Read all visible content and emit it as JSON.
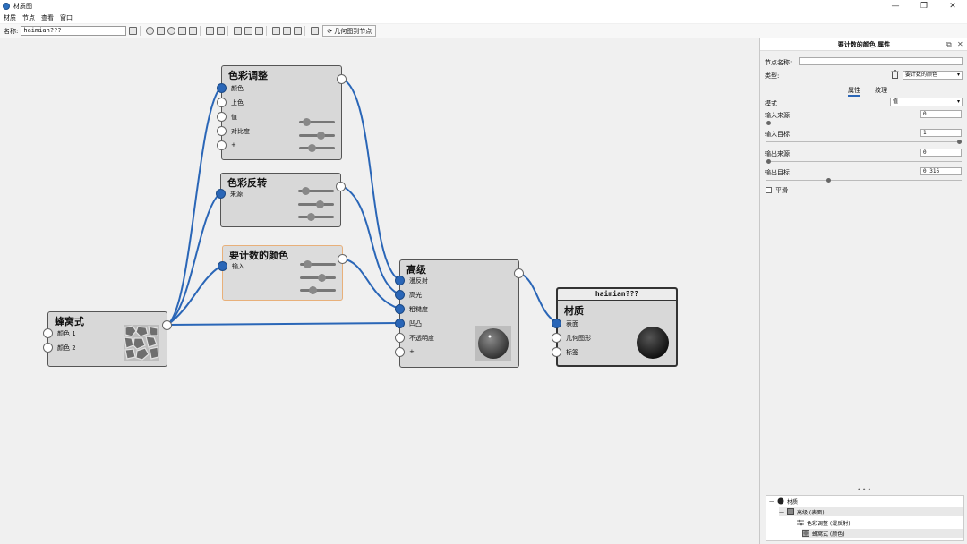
{
  "window": {
    "title": "材质图",
    "btn_min": "—",
    "btn_restore": "❐",
    "btn_close": "✕"
  },
  "menu": [
    "材质",
    "节点",
    "查看",
    "窗口"
  ],
  "toolbar": {
    "name_label": "名称:",
    "name_value": "haimian???",
    "geo_button": "几何图到节点",
    "geo_icon": "⟳"
  },
  "nodes": {
    "color_adjust": {
      "title": "色彩调整",
      "ports": [
        "颜色",
        "上色",
        "值",
        "对比度",
        "+"
      ]
    },
    "color_invert": {
      "title": "色彩反转",
      "ports": [
        "来源"
      ]
    },
    "count_color": {
      "title": "要计数的颜色",
      "ports": [
        "输入"
      ]
    },
    "honeycomb": {
      "title": "蜂窝式",
      "ports": [
        "颜色 1",
        "颜色 2"
      ]
    },
    "advanced": {
      "title": "高级",
      "ports": [
        "漫反射",
        "高光",
        "粗糙度",
        "凹凸",
        "不透明度",
        "+"
      ]
    },
    "material": {
      "header": "haimian???",
      "title": "材质",
      "ports": [
        "表面",
        "几何图形",
        "标签"
      ]
    }
  },
  "panel": {
    "header": "要计数的颜色 属性",
    "ctl_float": "⧉",
    "ctl_close": "✕",
    "node_name_label": "节点名称:",
    "node_name_value": "",
    "type_label": "类型:",
    "type_value": "要计数的颜色",
    "tabs": [
      "属性",
      "纹理"
    ],
    "mode_label": "模式",
    "mode_value": "值",
    "fields": [
      {
        "label": "输入来源",
        "value": "0",
        "level": 0.0
      },
      {
        "label": "输入目标",
        "value": "1",
        "level": 1.0
      },
      {
        "label": "输出来源",
        "value": "0",
        "level": 0.0
      },
      {
        "label": "输出目标",
        "value": "0.316",
        "level": 0.316
      }
    ],
    "smooth_label": "平滑",
    "tree": [
      {
        "label": "材质",
        "icon": "sphere-icon"
      },
      {
        "label": "高级 (表面)",
        "icon": "advanced-icon"
      },
      {
        "label": "色彩调整 (漫反射)",
        "icon": "adjust-icon"
      },
      {
        "label": "蜂窝式 (颜色)",
        "icon": "honeycomb-icon"
      }
    ]
  },
  "colors": {
    "accent": "#2a66b7",
    "selected_border": "#e8b07a",
    "wire": "#2a66b7"
  }
}
